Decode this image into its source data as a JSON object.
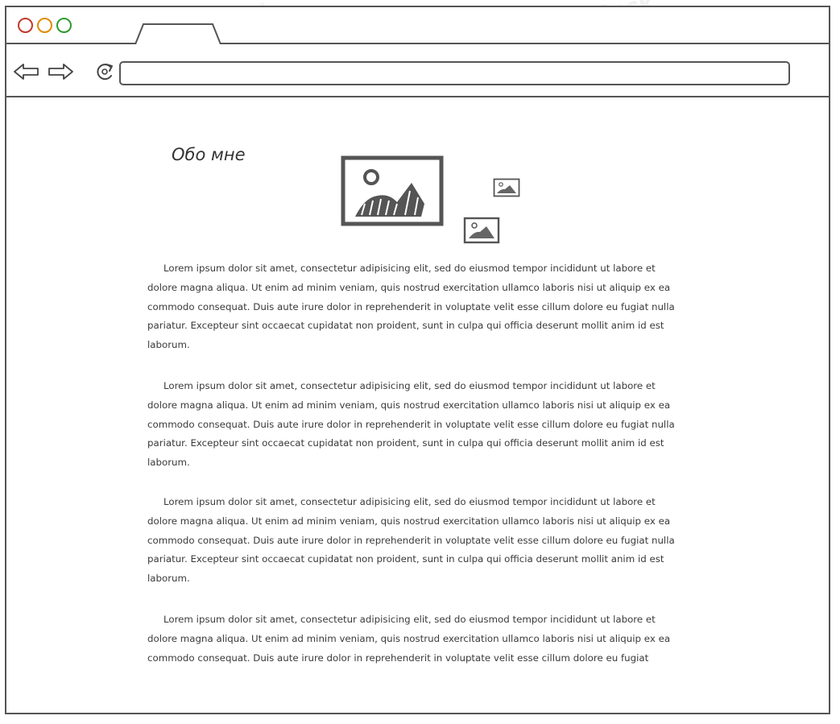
{
  "window": {
    "title_tab": "",
    "controls": [
      "close",
      "minimize",
      "maximize"
    ]
  },
  "toolbar": {
    "back_icon": "arrow-left-icon",
    "forward_icon": "arrow-right-icon",
    "reload_icon": "reload-icon",
    "address_value": ""
  },
  "watermark": "NinjaMock",
  "page": {
    "title": "Обо мне",
    "images": [
      "image-placeholder-large",
      "image-placeholder-small",
      "image-placeholder-small"
    ],
    "paragraphs": [
      "Lorem ipsum dolor sit amet, consectetur adipisicing elit, sed do eiusmod tempor incididunt ut labore et dolore magna aliqua. Ut enim ad minim veniam, quis nostrud exercitation ullamco laboris nisi ut aliquip ex ea commodo consequat. Duis aute irure dolor in reprehenderit in voluptate velit esse cillum dolore eu fugiat nulla pariatur. Excepteur sint occaecat cupidatat non proident, sunt in culpa qui officia deserunt mollit anim id est laborum.",
      "Lorem ipsum dolor sit amet, consectetur adipisicing elit, sed do eiusmod tempor incididunt ut labore et dolore magna aliqua. Ut enim ad minim veniam, quis nostrud exercitation ullamco laboris nisi ut aliquip ex ea commodo consequat. Duis aute irure dolor in reprehenderit in voluptate velit esse cillum dolore eu fugiat nulla pariatur. Excepteur sint occaecat cupidatat non proident, sunt in culpa qui officia deserunt mollit anim id est laborum.",
      "Lorem ipsum dolor sit amet, consectetur adipisicing elit, sed do eiusmod tempor incididunt ut labore et dolore magna aliqua. Ut enim ad minim veniam, quis nostrud exercitation ullamco laboris nisi ut aliquip ex ea commodo consequat. Duis aute irure dolor in reprehenderit in voluptate velit esse cillum dolore eu fugiat nulla pariatur. Excepteur sint occaecat cupidatat non proident, sunt in culpa qui officia deserunt mollit anim id est laborum.",
      "Lorem ipsum dolor sit amet, consectetur adipisicing elit, sed do eiusmod tempor incididunt ut labore et dolore magna aliqua. Ut enim ad minim veniam, quis nostrud exercitation ullamco laboris nisi ut aliquip ex ea commodo consequat. Duis aute irure dolor in reprehenderit in voluptate velit esse cillum dolore eu fugiat"
    ]
  },
  "colors": {
    "close": "#c0392b",
    "minimize": "#e08a00",
    "maximize": "#2e9a2e",
    "stroke": "#555555"
  }
}
